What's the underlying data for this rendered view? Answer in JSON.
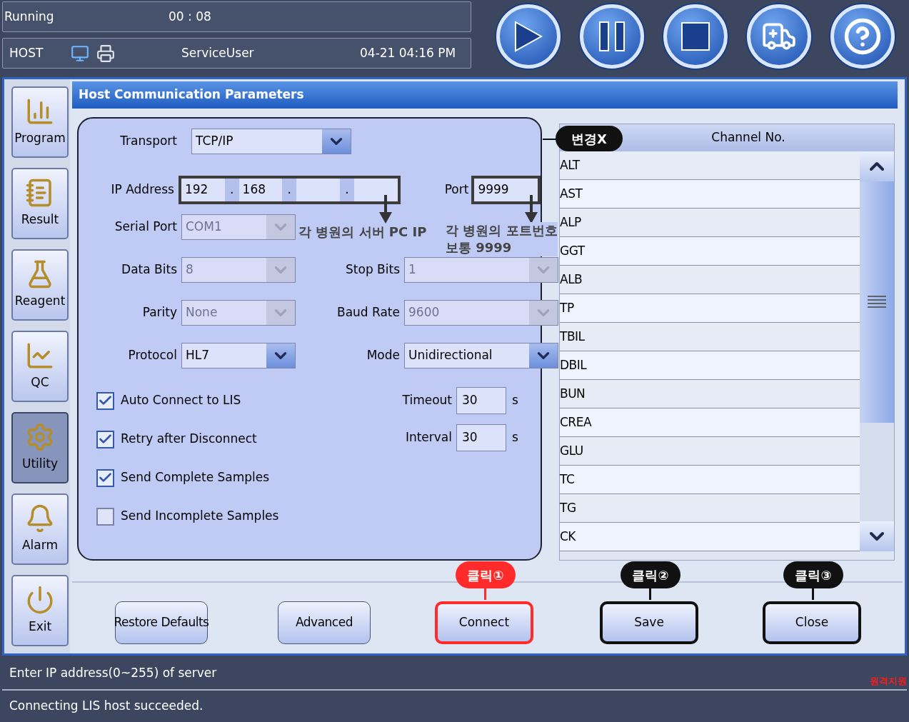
{
  "status": {
    "state": "Running",
    "timer": "00 : 08",
    "mode": "HOST",
    "user": "ServiceUser",
    "datetime": "04-21 04:16 PM"
  },
  "sidebar": {
    "items": [
      {
        "label": "Program",
        "selected": false
      },
      {
        "label": "Result",
        "selected": false
      },
      {
        "label": "Reagent",
        "selected": false
      },
      {
        "label": "QC",
        "selected": false
      },
      {
        "label": "Utility",
        "selected": true
      },
      {
        "label": "Alarm",
        "selected": false
      },
      {
        "label": "Exit",
        "selected": false
      }
    ]
  },
  "title": "Host Communication Parameters",
  "form": {
    "transport": {
      "label": "Transport",
      "value": "TCP/IP"
    },
    "ip_address": {
      "label": "IP Address",
      "octets": [
        "192",
        "168"
      ],
      "separator": ".",
      "note": "각 병원의 서버 PC IP"
    },
    "port": {
      "label": "Port",
      "value": "9999",
      "note": "각 병원의 포트번호\n보통 9999"
    },
    "left_selects": [
      {
        "label": "Serial Port",
        "value": "COM1",
        "disabled": true
      },
      {
        "label": "Data Bits",
        "value": "8",
        "disabled": true
      },
      {
        "label": "Parity",
        "value": "None",
        "disabled": true
      },
      {
        "label": "Protocol",
        "value": "HL7",
        "disabled": false
      }
    ],
    "right_selects": [
      {
        "label": "Stop Bits",
        "value": "1",
        "disabled": true
      },
      {
        "label": "Baud Rate",
        "value": "9600",
        "disabled": true
      },
      {
        "label": "Mode",
        "value": "Unidirectional",
        "disabled": false
      }
    ],
    "checkboxes": [
      {
        "label": "Auto Connect to LIS",
        "checked": true
      },
      {
        "label": "Retry after Disconnect",
        "checked": true
      },
      {
        "label": "Send Complete Samples",
        "checked": true
      },
      {
        "label": "Send Incomplete Samples",
        "checked": false
      }
    ],
    "timing": [
      {
        "label": "Timeout",
        "value": "30",
        "unit": "s"
      },
      {
        "label": "Interval",
        "value": "30",
        "unit": "s"
      }
    ]
  },
  "channel_list": {
    "column_2": "Channel No.",
    "badge": "변경X",
    "rows": [
      "ALT",
      "AST",
      "ALP",
      "GGT",
      "ALB",
      "TP",
      "TBIL",
      "DBIL",
      "BUN",
      "CREA",
      "GLU",
      "TC",
      "TG",
      "CK"
    ]
  },
  "buttons": [
    {
      "label": "Restore Defaults"
    },
    {
      "label": "Advanced"
    },
    {
      "label": "Connect",
      "callout": {
        "text": "클릭①",
        "color": "#ff2a2a"
      }
    },
    {
      "label": "Save",
      "callout": {
        "text": "클릭②",
        "color": "#111111"
      }
    },
    {
      "label": "Close",
      "callout": {
        "text": "클릭③",
        "color": "#111111"
      }
    }
  ],
  "messages": [
    "Enter IP address(0~255) of server",
    "Connecting LIS host succeeded."
  ],
  "overlay_text": "원격지원"
}
